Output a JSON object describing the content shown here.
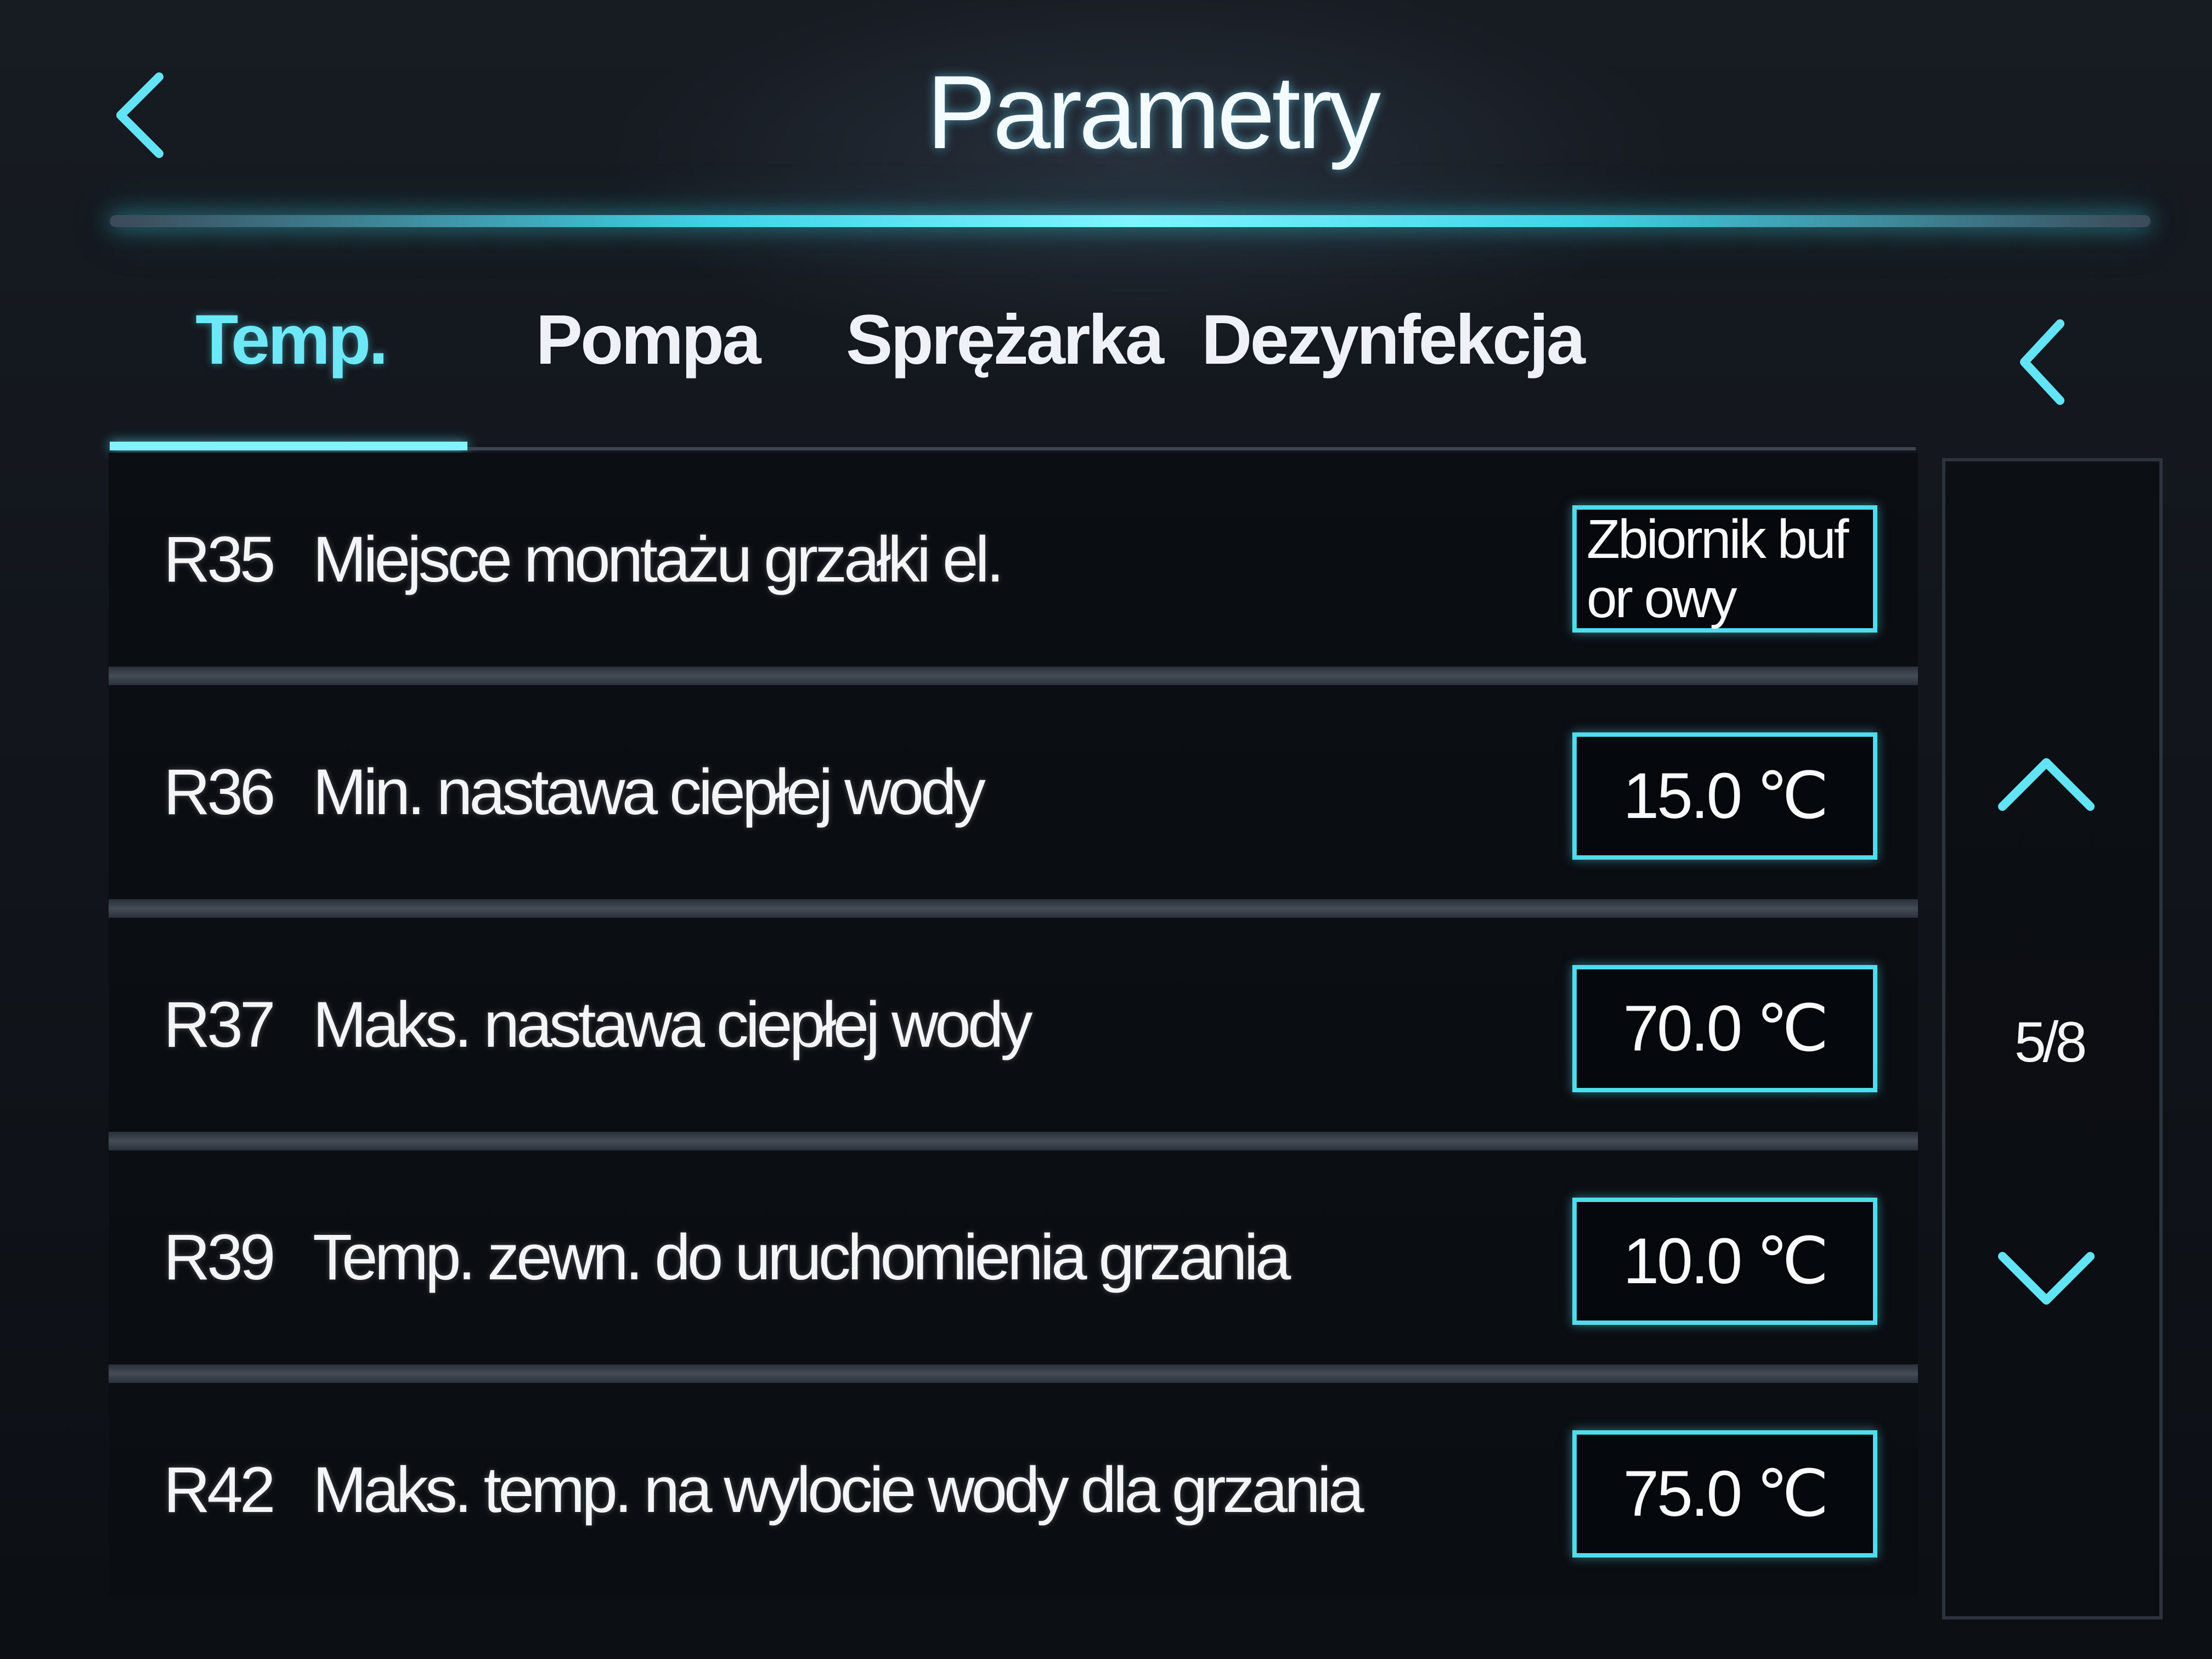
{
  "header": {
    "title": "Parametry",
    "back_icon": "chevron-left-icon"
  },
  "tabs": [
    {
      "label": "Temp.",
      "active": true
    },
    {
      "label": "Pompa",
      "active": false
    },
    {
      "label": "Sprężarka",
      "active": false
    },
    {
      "label": "Dezynfekcja",
      "active": false
    }
  ],
  "tabs_nav": {
    "prev_icon": "chevron-left-icon"
  },
  "parameters": [
    {
      "code": "R35",
      "name": "Miejsce montażu grzałki el.",
      "value": "Zbiornik bufor owy"
    },
    {
      "code": "R36",
      "name": "Min. nastawa ciepłej wody",
      "value": "15.0 ℃"
    },
    {
      "code": "R37",
      "name": "Maks. nastawa ciepłej wody",
      "value": "70.0 ℃"
    },
    {
      "code": "R39",
      "name": "Temp. zewn. do uruchomienia grzania",
      "value": "10.0 ℃"
    },
    {
      "code": "R42",
      "name": "Maks. temp. na wylocie wody dla grzania",
      "value": "75.0 ℃"
    }
  ],
  "pagination": {
    "indicator": "5/8",
    "current_page": 5,
    "total_pages": 8,
    "up_icon": "chevron-up-icon",
    "down_icon": "chevron-down-icon"
  },
  "colors": {
    "accent": "#4fdcec",
    "background": "#0d1016",
    "text": "#ffffff"
  }
}
